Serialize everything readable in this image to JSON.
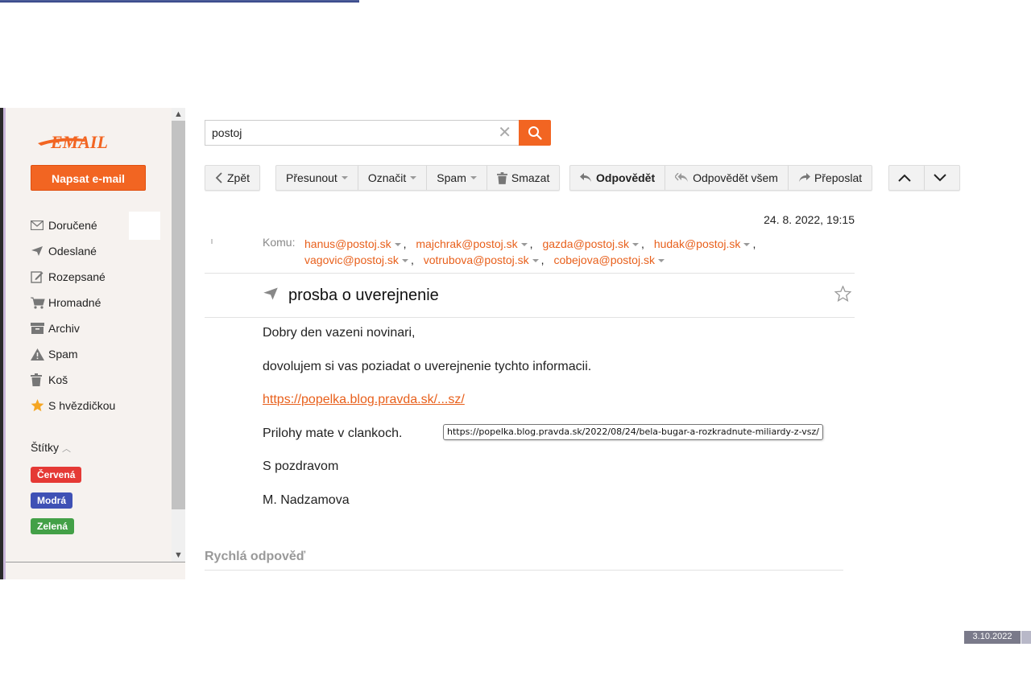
{
  "app": {
    "brand_color": "#f26522",
    "link_color": "#e8601c",
    "logo_text": "EMAIL"
  },
  "sidebar": {
    "compose_label": "Napsat e-mail",
    "folders": [
      {
        "label": "Doručené",
        "icon": "inbox-icon"
      },
      {
        "label": "Odeslané",
        "icon": "send-icon"
      },
      {
        "label": "Rozepsané",
        "icon": "draft-icon"
      },
      {
        "label": "Hromadné",
        "icon": "cart-icon"
      },
      {
        "label": "Archiv",
        "icon": "archive-icon"
      },
      {
        "label": "Spam",
        "icon": "warning-icon"
      },
      {
        "label": "Koš",
        "icon": "trash-icon"
      },
      {
        "label": "S hvězdičkou",
        "icon": "star-icon"
      }
    ],
    "labels_title": "Štítky",
    "tags": [
      {
        "label": "Červená",
        "color": "#e53935"
      },
      {
        "label": "Modrá",
        "color": "#3f51b5"
      },
      {
        "label": "Zelená",
        "color": "#43a047"
      }
    ]
  },
  "search": {
    "value": "postoj"
  },
  "toolbar": {
    "back": "Zpět",
    "move": "Přesunout",
    "mark": "Označit",
    "spam": "Spam",
    "delete": "Smazat",
    "reply": "Odpovědět",
    "reply_all": "Odpovědět všem",
    "forward": "Přeposlat"
  },
  "message": {
    "date": "24. 8. 2022, 19:15",
    "to_label": "Komu:",
    "recipients": [
      "hanus@postoj.sk",
      "majchrak@postoj.sk",
      "gazda@postoj.sk",
      "hudak@postoj.sk",
      "vagovic@postoj.sk",
      "votrubova@postoj.sk",
      "cobejova@postoj.sk"
    ],
    "subject": "prosba o uverejnenie",
    "body": {
      "greeting": "Dobry den vazeni novinari,",
      "line1": "dovolujem si vas poziadat o uverejnenie tychto informacii.",
      "link": "https://popelka.blog.pravda.sk/...sz/",
      "line2": "Prilohy mate v clankoch.",
      "regards": "S pozdravom",
      "signature": "M. Nadzamova"
    },
    "tooltip": "https://popelka.blog.pravda.sk/2022/08/24/bela-bugar-a-rozkradnute-miliardy-z-vsz/"
  },
  "quick_reply": {
    "title": "Rychlá odpověď"
  },
  "taskbar": {
    "clock": "3.10.2022"
  }
}
